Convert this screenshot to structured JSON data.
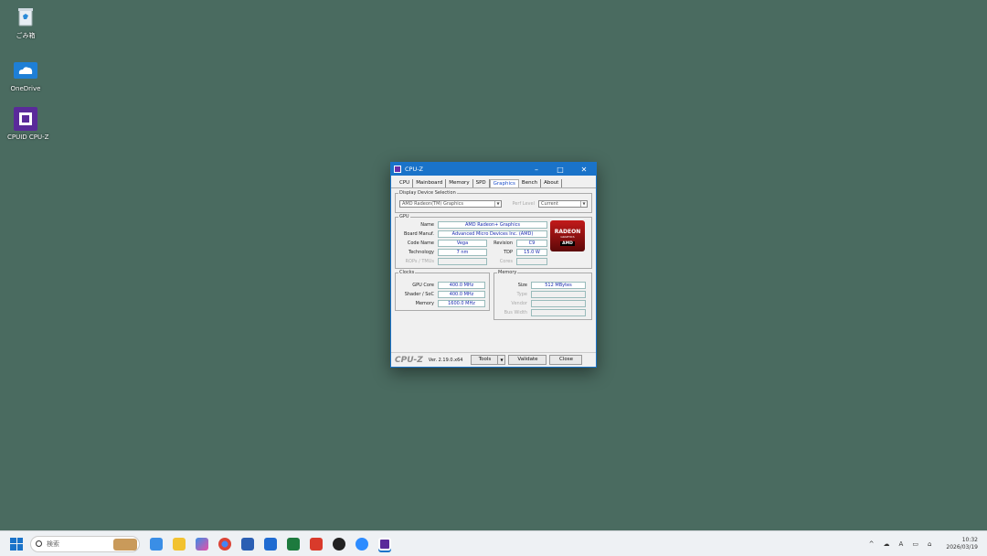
{
  "desktop": {
    "icons": [
      {
        "label": "ごみ箱"
      },
      {
        "label": "OneDrive"
      },
      {
        "label": "CPUID CPU-Z"
      }
    ]
  },
  "window": {
    "title": "CPU-Z",
    "tabs": [
      "CPU",
      "Mainboard",
      "Memory",
      "SPD",
      "Graphics",
      "Bench",
      "About"
    ],
    "active_tab": "Graphics",
    "display_group_title": "Display Device Selection",
    "device_select": "AMD Radeon(TM) Graphics",
    "perf_label": "Perf Level",
    "perf_select": "Current",
    "gpu_group_title": "GPU",
    "gpu": {
      "name_label": "Name",
      "name": "AMD Radeon+ Graphics",
      "board_label": "Board Manuf.",
      "board": "Advanced Micro Devices Inc. (AMD)",
      "code_label": "Code Name",
      "code": "Vega",
      "revision_label": "Revision",
      "revision": "C9",
      "tech_label": "Technology",
      "tech": "7 nm",
      "tdp_label": "TDP",
      "tdp": "15.0 W",
      "rops_label": "ROPs / TMUs",
      "cores_label": "Cores"
    },
    "logo": {
      "line1": "RADEON",
      "line2": "GRAPHICS",
      "line3": "AMD"
    },
    "clocks_group_title": "Clocks",
    "clocks": {
      "core_label": "GPU Core",
      "core": "400.0 MHz",
      "shader_label": "Shader / SoC",
      "shader": "400.0 MHz",
      "memory_label": "Memory",
      "memory": "1600.0 MHz"
    },
    "memory_group_title": "Memory",
    "memory": {
      "size_label": "Size",
      "size": "512 MBytes",
      "type_label": "Type",
      "vendor_label": "Vendor",
      "bus_label": "Bus Width"
    },
    "footer": {
      "brand": "CPU-Z",
      "version": "Ver. 2.19.0.x64",
      "tools": "Tools",
      "validate": "Validate",
      "close": "Close"
    }
  },
  "taskbar": {
    "search_placeholder": "検索",
    "time": "10:32",
    "date": "2026/03/19",
    "ime": "A"
  }
}
